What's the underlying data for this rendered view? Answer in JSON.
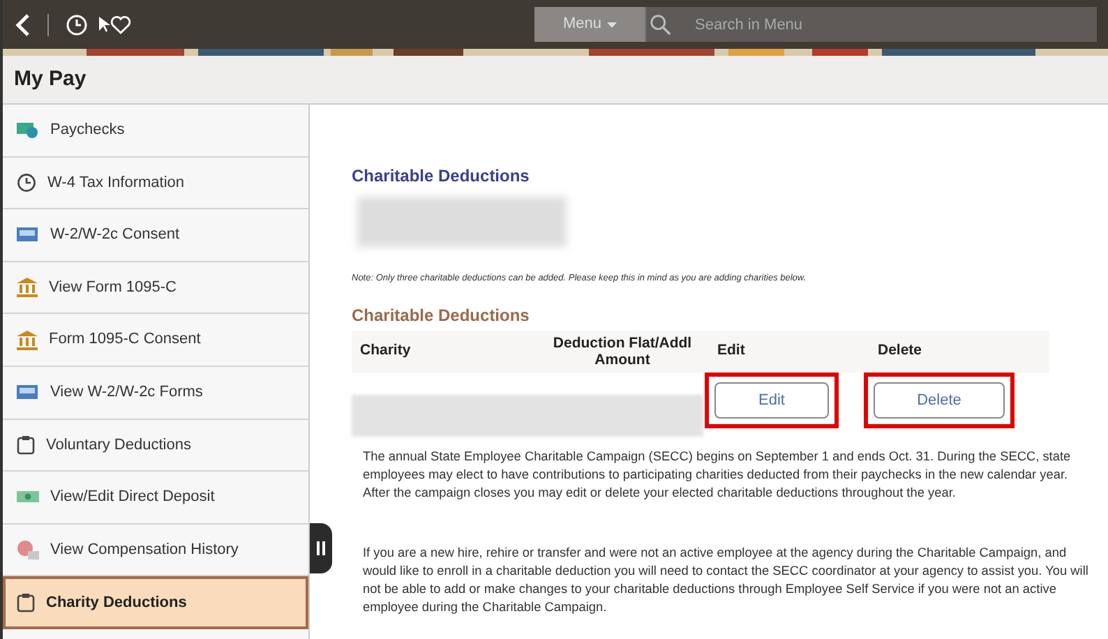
{
  "header": {
    "menu_button": "Menu",
    "search": {
      "placeholder": "Search in Menu"
    }
  },
  "page_title": "My Pay",
  "sidebar": {
    "items": [
      {
        "label": "Paychecks",
        "kind": "paycheck",
        "selected": false
      },
      {
        "label": "W-4 Tax Information",
        "kind": "clock",
        "selected": false
      },
      {
        "label": "W-2/W-2c Consent",
        "kind": "form",
        "selected": false
      },
      {
        "label": "View Form 1095-C",
        "kind": "bank",
        "selected": false
      },
      {
        "label": "Form 1095-C Consent",
        "kind": "bank",
        "selected": false
      },
      {
        "label": "View W-2/W-2c Forms",
        "kind": "form",
        "selected": false
      },
      {
        "label": "Voluntary Deductions",
        "kind": "clipboard",
        "selected": false
      },
      {
        "label": "View/Edit Direct Deposit",
        "kind": "money",
        "selected": false
      },
      {
        "label": "View Compensation History",
        "kind": "chart",
        "selected": false
      },
      {
        "label": "Charity Deductions",
        "kind": "clipboard",
        "selected": true
      }
    ]
  },
  "content": {
    "title": "Charitable Deductions",
    "note": "Note: Only three charitable deductions can be added. Please keep this in mind as you are adding charities below.",
    "section_title": "Charitable Deductions",
    "table": {
      "columns": [
        "Charity",
        "Deduction Flat/Addl Amount",
        "Edit",
        "Delete"
      ],
      "rows": [
        {
          "edit": "Edit",
          "delete": "Delete"
        }
      ]
    },
    "paragraphs": [
      "The annual State Employee Charitable Campaign (SECC) begins on September 1 and ends Oct. 31. During the SECC, state employees may elect to have contributions to participating charities deducted from their paychecks in the new calendar year. After the campaign closes you may edit or delete your elected charitable deductions throughout the year.",
      "If you are a new hire, rehire or transfer and were not an active employee at the agency during the Charitable Campaign, and would like to enroll in a charitable deduction you will need to contact the SECC coordinator at your agency to assist you. You will not be able to add or make changes to your charitable deductions through Employee Self Service if you were not an active employee during the Charitable Campaign."
    ]
  }
}
